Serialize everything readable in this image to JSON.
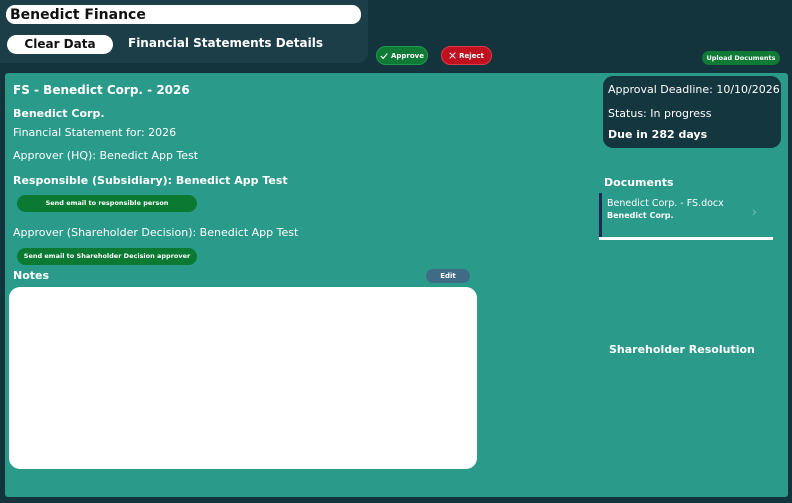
{
  "header": {
    "app_title": "Benedict Finance",
    "clear_label": "Clear Data",
    "page_title": "Financial Statements Details"
  },
  "actions": {
    "approve_label": "Approve",
    "reject_label": "Reject",
    "upload_label": "Upload Documents"
  },
  "statement": {
    "title": "FS - Benedict Corp. - 2026",
    "company": "Benedict Corp.",
    "statement_for": "Financial Statement for: 2026",
    "approver_hq": "Approver (HQ): Benedict App Test",
    "responsible": "Responsible (Subsidiary): Benedict App Test",
    "email_responsible_label": "Send email to responsible person",
    "approver_shareholder": "Approver (Shareholder Decision): Benedict App Test",
    "email_shareholder_label": "Send email to Shareholder Decision approver",
    "notes_label": "Notes",
    "edit_label": "Edit"
  },
  "status_card": {
    "deadline": "Approval Deadline: 10/10/2026",
    "status": "Status: In progress",
    "due": "Due in 282 days"
  },
  "documents": {
    "label": "Documents",
    "items": [
      {
        "name": "Benedict Corp. - FS.docx",
        "company": "Benedict Corp."
      }
    ]
  },
  "shareholder_resolution_label": "Shareholder Resolution",
  "colors": {
    "background": "#13343c",
    "panel": "#2a9b8b",
    "approve": "#0f7a35",
    "reject": "#c01020",
    "edit": "#3f6b86"
  }
}
